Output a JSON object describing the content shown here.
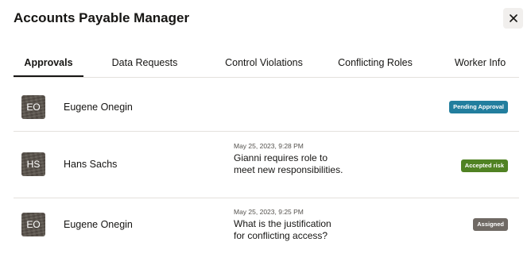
{
  "dialog": {
    "title": "Accounts Payable Manager",
    "close_label": "Close"
  },
  "tabs": [
    {
      "label": "Approvals",
      "active": true
    },
    {
      "label": "Data Requests",
      "active": false
    },
    {
      "label": "Control Violations",
      "active": false
    },
    {
      "label": "Conflicting Roles",
      "active": false
    },
    {
      "label": "Worker Info",
      "active": false
    }
  ],
  "approvals": [
    {
      "initials": "EO",
      "name": "Eugene Onegin",
      "badge": {
        "label": "Pending Approval",
        "color": "#227e9e"
      }
    },
    {
      "initials": "HS",
      "name": "Hans Sachs",
      "message": {
        "timestamp": "May 25, 2023, 9:28 PM",
        "text": "Gianni requires role to meet new responsibilities."
      },
      "badge": {
        "label": "Accepted risk",
        "color": "#508223"
      }
    },
    {
      "initials": "EO",
      "name": "Eugene Onegin",
      "message": {
        "timestamp": "May 25, 2023, 9:25 PM",
        "text": "What is the justification for conflicting access?"
      },
      "badge": {
        "label": "Assigned",
        "color": "#6f6964"
      }
    }
  ]
}
